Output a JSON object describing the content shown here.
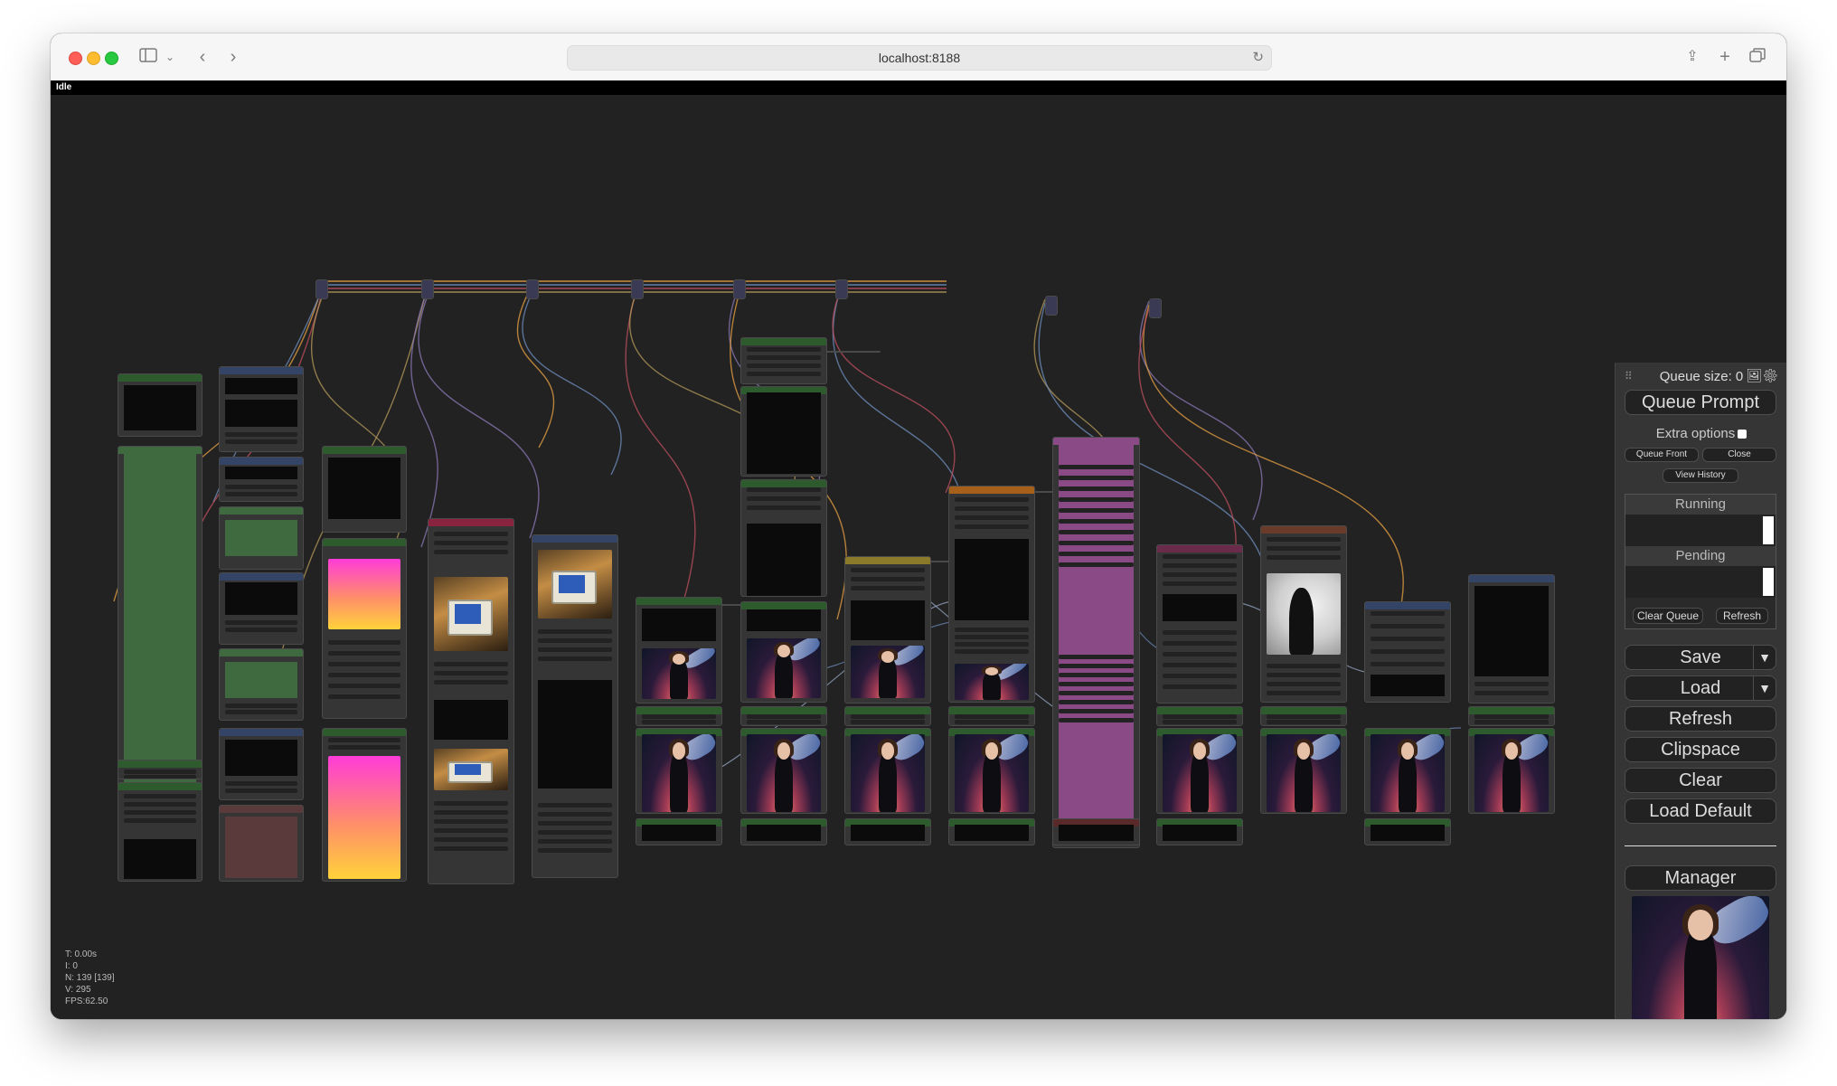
{
  "browser": {
    "url": "localhost:8188",
    "icons": [
      "sidebar-icon",
      "chevron-down-icon",
      "back-icon",
      "forward-icon",
      "reload-icon",
      "share-icon",
      "new-tab-icon",
      "tabs-overview-icon"
    ]
  },
  "status": {
    "text": "Idle"
  },
  "canvas_stats": {
    "t": "T: 0.00s",
    "i": "I: 0",
    "n": "N: 139 [139]",
    "v": "V: 295",
    "fps": "FPS:62.50"
  },
  "menu": {
    "queue_size": "Queue size: 0",
    "queue_prompt": "Queue Prompt",
    "extra_options": "Extra options",
    "queue_front": "Queue Front",
    "close": "Close",
    "view_history": "View History",
    "running": "Running",
    "pending": "Pending",
    "clear_queue": "Clear Queue",
    "refresh_small": "Refresh",
    "save": "Save",
    "load": "Load",
    "refresh": "Refresh",
    "clipspace": "Clipspace",
    "clear": "Clear",
    "load_default": "Load Default",
    "manager": "Manager",
    "dropdown_arrow": "▼"
  },
  "colors": {
    "canvas": "#222222",
    "node": "#353535",
    "green_group": "#3f6a3f",
    "pink_group": "#8a4a86",
    "wire_orange": "#e8a244",
    "wire_blue": "#6f8fbf",
    "wire_red": "#c05060"
  }
}
